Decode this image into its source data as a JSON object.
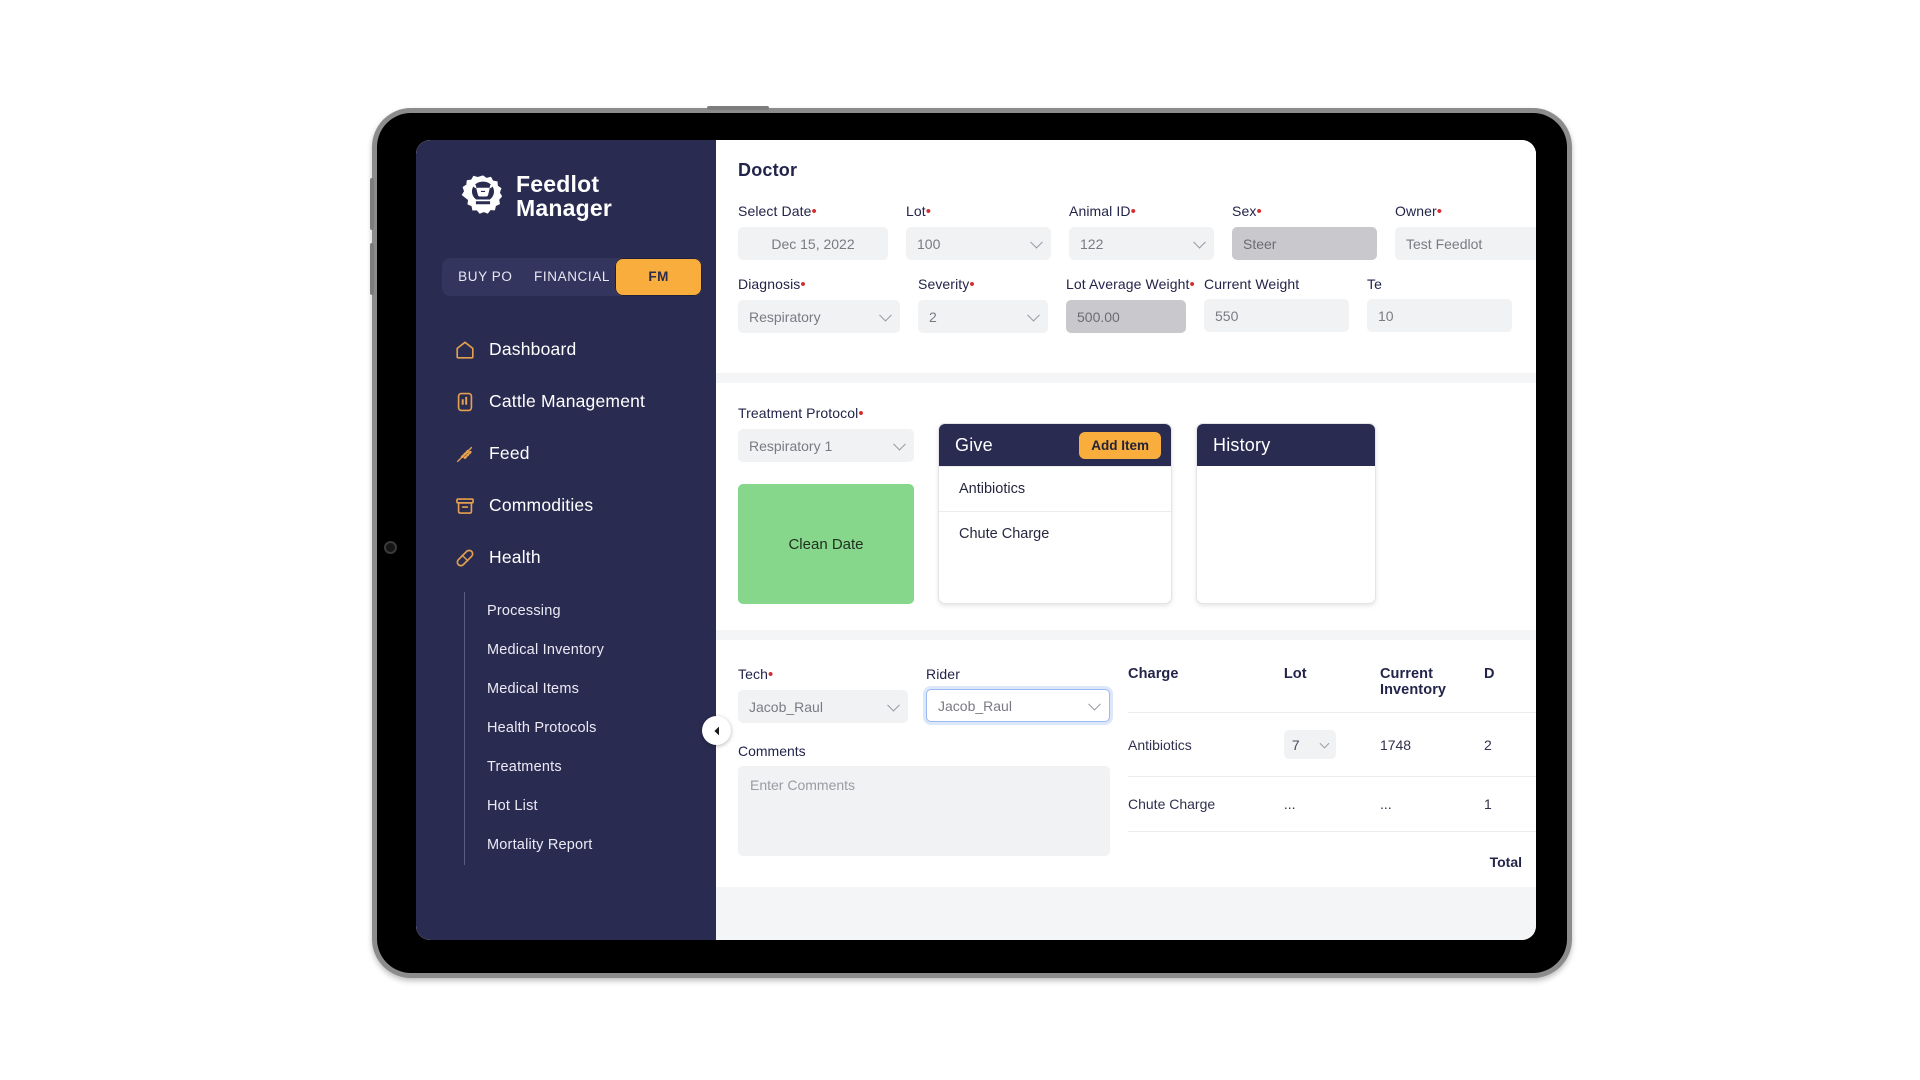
{
  "brand": {
    "line1": "Feedlot",
    "line2": "Manager",
    "logo_icon": "gear-cow-logo-icon"
  },
  "sidebar": {
    "segmented_tabs": [
      {
        "label": "BUY PO",
        "active": false
      },
      {
        "label": "FINANCIAL",
        "active": false
      },
      {
        "label": "FM",
        "active": true
      }
    ],
    "accent_color": "#f9ad3c",
    "background_color": "#2a2b51",
    "items": [
      {
        "label": "Dashboard",
        "icon": "home-icon"
      },
      {
        "label": "Cattle Management",
        "icon": "cattle-card-icon"
      },
      {
        "label": "Feed",
        "icon": "wheat-icon"
      },
      {
        "label": "Commodities",
        "icon": "box-icon"
      },
      {
        "label": "Health",
        "icon": "bandage-icon"
      }
    ],
    "sub_items": [
      {
        "label": "Processing"
      },
      {
        "label": "Medical Inventory"
      },
      {
        "label": "Medical Items"
      },
      {
        "label": "Health Protocols"
      },
      {
        "label": "Treatments"
      },
      {
        "label": "Hot List"
      },
      {
        "label": "Mortality Report"
      }
    ],
    "collapse_icon": "chevron-left-icon"
  },
  "main": {
    "page_title": "Doctor",
    "row1": [
      {
        "label": "Select Date",
        "required": true,
        "value": "Dec 15, 2022",
        "type": "date",
        "state": "normal"
      },
      {
        "label": "Lot",
        "required": true,
        "value": "100",
        "type": "select",
        "state": "normal"
      },
      {
        "label": "Animal ID",
        "required": true,
        "value": "122",
        "type": "select",
        "state": "normal"
      },
      {
        "label": "Sex",
        "required": true,
        "value": "Steer",
        "type": "text",
        "state": "disabled"
      },
      {
        "label": "Owner",
        "required": true,
        "value": "Test Feedlot",
        "type": "text",
        "state": "normal"
      }
    ],
    "row2": [
      {
        "label": "Diagnosis",
        "required": true,
        "value": "Respiratory",
        "type": "select",
        "state": "normal"
      },
      {
        "label": "Severity",
        "required": true,
        "value": "2",
        "type": "select",
        "state": "normal"
      },
      {
        "label": "Lot Average Weight",
        "required": true,
        "value": "500.00",
        "type": "text",
        "state": "disabled"
      },
      {
        "label": "Current Weight",
        "required": false,
        "value": "550",
        "type": "text",
        "state": "normal"
      },
      {
        "label": "Te",
        "required": false,
        "value": "10",
        "type": "text",
        "state": "normal"
      }
    ],
    "treatment_protocol": {
      "label": "Treatment Protocol",
      "required": true,
      "value": "Respiratory 1"
    },
    "clean_date_button": "Clean Date",
    "give_panel": {
      "title": "Give",
      "add_item_label": "Add Item",
      "rows": [
        "Antibiotics",
        "Chute Charge"
      ]
    },
    "history_panel": {
      "title": "History"
    },
    "tech": {
      "label": "Tech",
      "required": true,
      "value": "Jacob_Raul"
    },
    "rider": {
      "label": "Rider",
      "required": false,
      "value": "Jacob_Raul"
    },
    "comments": {
      "label": "Comments",
      "placeholder": "Enter Comments",
      "value": ""
    },
    "charges_table": {
      "columns": [
        "Charge",
        "Lot",
        "Current Inventory",
        "D"
      ],
      "rows": [
        {
          "charge": "Antibiotics",
          "lot": "7",
          "lot_is_select": true,
          "current_inventory": "1748",
          "d": "2"
        },
        {
          "charge": "Chute Charge",
          "lot": "...",
          "lot_is_select": false,
          "current_inventory": "...",
          "d": "1"
        }
      ],
      "total_label": "Total"
    }
  }
}
